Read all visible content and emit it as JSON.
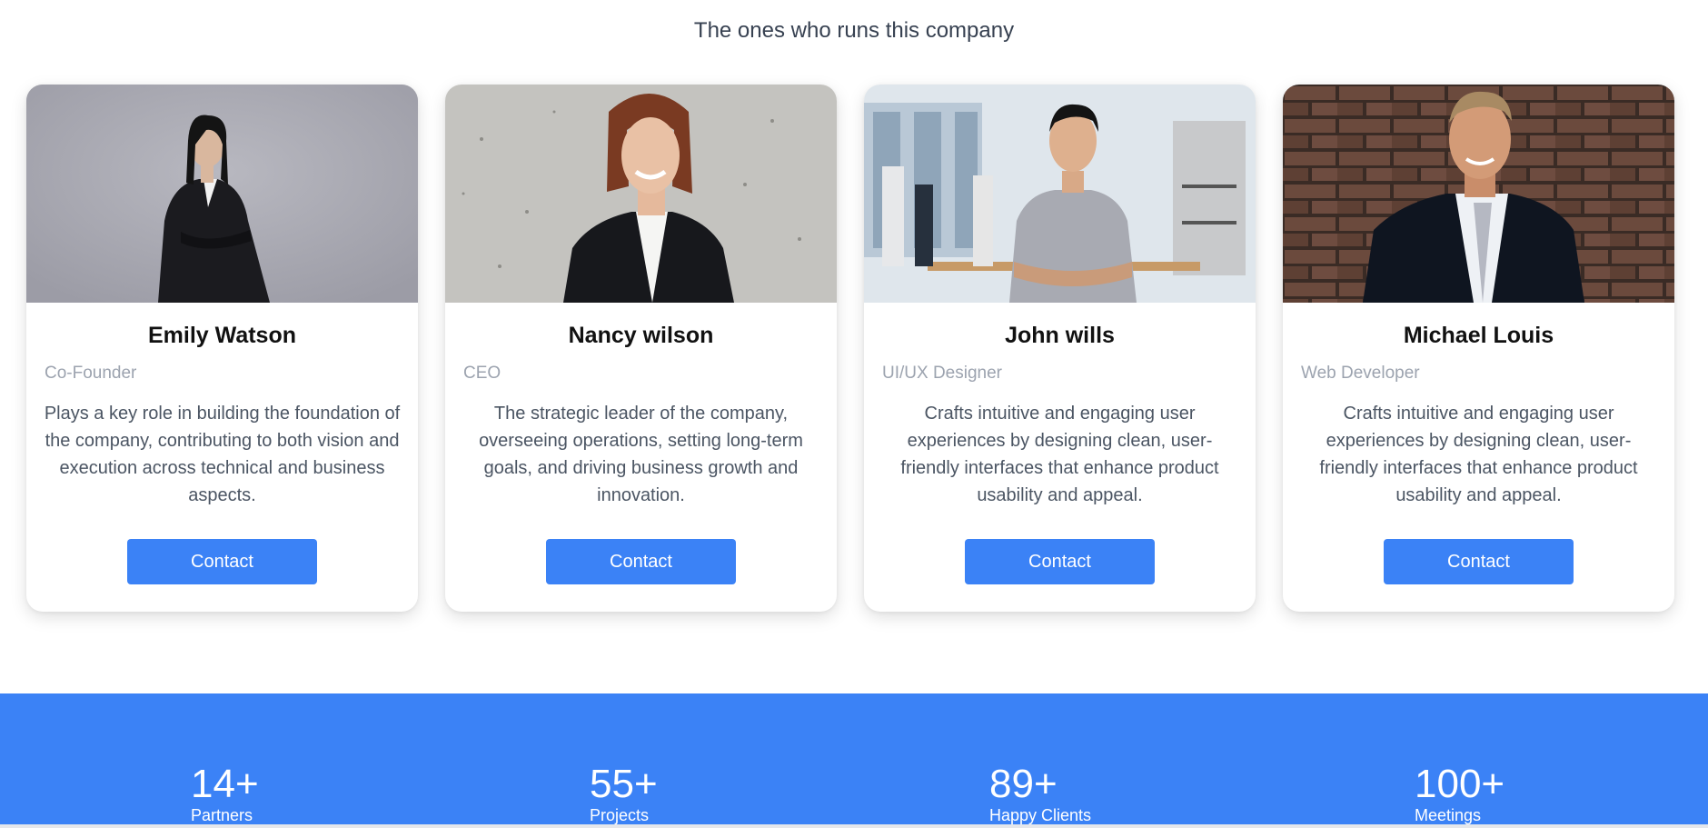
{
  "team": {
    "title": "The ones who runs this company",
    "contact_label": "Contact",
    "members": [
      {
        "name": "Emily Watson",
        "role": "Co-Founder",
        "description": "Plays a key role in building the foundation of the company, contributing to both vision and execution across technical and business aspects."
      },
      {
        "name": "Nancy wilson",
        "role": "CEO",
        "description": "The strategic leader of the company, overseeing operations, setting long-term goals, and driving business growth and innovation."
      },
      {
        "name": "John wills",
        "role": "UI/UX Designer",
        "description": "Crafts intuitive and engaging user experiences by designing clean, user-friendly interfaces that enhance product usability and appeal."
      },
      {
        "name": "Michael Louis",
        "role": "Web Developer",
        "description": "Crafts intuitive and engaging user experiences by designing clean, user-friendly interfaces that enhance product usability and appeal."
      }
    ]
  },
  "stats": [
    {
      "value": "14+",
      "label": "Partners"
    },
    {
      "value": "55+",
      "label": "Projects"
    },
    {
      "value": "89+",
      "label": "Happy Clients"
    },
    {
      "value": "100+",
      "label": "Meetings"
    }
  ],
  "colors": {
    "accent": "#3b82f6"
  }
}
